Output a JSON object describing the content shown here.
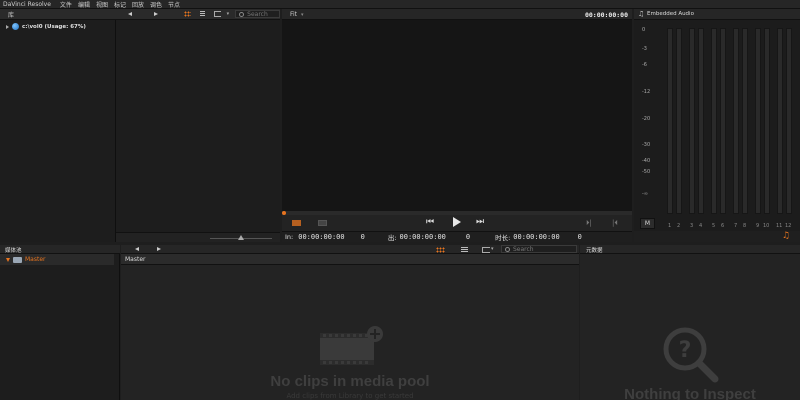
{
  "app": {
    "title": "DaVinci Resolve"
  },
  "menu": {
    "items": [
      "文件",
      "编辑",
      "视图",
      "标记",
      "回放",
      "调色",
      "节点"
    ]
  },
  "library": {
    "title": "库",
    "volume_label": "c:\\vol0 (Usage: 67%)",
    "search_placeholder": "Search"
  },
  "viewer": {
    "fit_label": "Fit",
    "timecode": "00:00:00:00",
    "in_label": "In:",
    "in_timecode": "00:00:00:00",
    "in_frames": "0",
    "out_label": "出:",
    "out_timecode": "00:00:00:00",
    "out_frames": "0",
    "duration_label": "时长:",
    "duration_timecode": "00:00:00:00",
    "duration_frames": "0"
  },
  "audio": {
    "title": "Embedded Audio",
    "db_scale": [
      "0",
      "-3",
      "-6",
      "-12",
      "-20",
      "-30",
      "-40",
      "-50",
      "-∞"
    ],
    "mute_label": "M",
    "channels": [
      "1",
      "2",
      "3",
      "4",
      "5",
      "6",
      "7",
      "8",
      "9",
      "10",
      "11",
      "12"
    ]
  },
  "media_pool": {
    "title": "媒体池",
    "bin_name": "Master",
    "header_bin": "Master",
    "search_placeholder": "Search",
    "empty_title": "No clips in media pool",
    "empty_subtitle": "Add clips from Library to get started"
  },
  "metadata": {
    "title": "元数据",
    "empty_title": "Nothing to Inspect"
  },
  "colors": {
    "accent": "#e7741f",
    "bg": "#1e1e1e",
    "panel": "#1c1c1c"
  }
}
